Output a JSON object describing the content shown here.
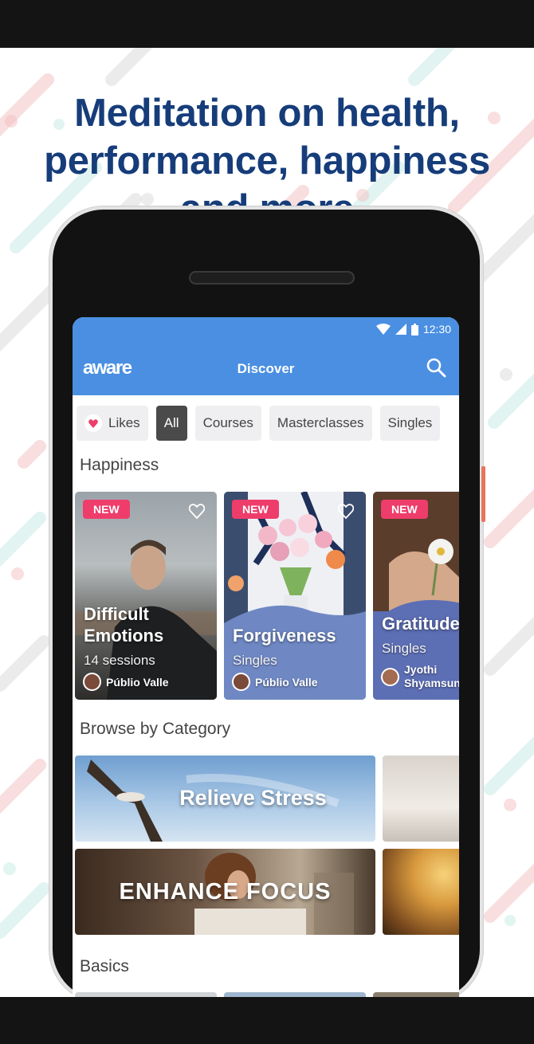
{
  "headline": {
    "line1": "Meditation on health,",
    "line2": "performance, happiness",
    "line3": "and more"
  },
  "status_bar": {
    "time": "12:30"
  },
  "app_bar": {
    "logo": "aware",
    "title": "Discover",
    "search_icon": "search-icon"
  },
  "filters": {
    "items": [
      {
        "label": "Likes",
        "icon": "heart-icon",
        "active": false
      },
      {
        "label": "All",
        "active": true
      },
      {
        "label": "Courses",
        "active": false
      },
      {
        "label": "Masterclasses",
        "active": false
      },
      {
        "label": "Singles",
        "active": false
      }
    ]
  },
  "sections": {
    "happiness": "Happiness",
    "browse": "Browse by Category",
    "basics": "Basics"
  },
  "happiness_cards": [
    {
      "badge": "NEW",
      "title_line1": "Difficult",
      "title_line2": "Emotions",
      "subtitle": "14 sessions",
      "author": "Públio Valle"
    },
    {
      "badge": "NEW",
      "title_line1": "Forgiveness",
      "subtitle": "Singles",
      "author": "Públio Valle"
    },
    {
      "badge": "NEW",
      "title_line1": "Gratitude",
      "subtitle": "Singles",
      "author_line1": "Jyothi",
      "author_line2": "Shyamsundar"
    }
  ],
  "categories": [
    {
      "label": "Relieve Stress"
    },
    {
      "label": "ENHANCE FOCUS"
    }
  ],
  "colors": {
    "headline": "#163d7a",
    "app_bar": "#4a8fe2",
    "new_badge": "#ee3d6b",
    "chip_active": "#4a4a4a"
  }
}
